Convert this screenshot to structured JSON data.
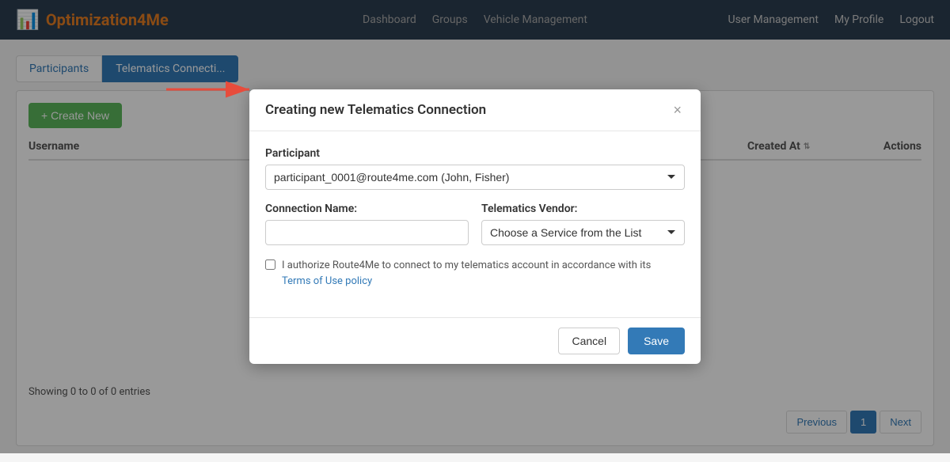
{
  "header": {
    "logo_text_before": "Optimization",
    "logo_text_highlight": "4Me",
    "nav_center": [
      "Dashboard",
      "Groups",
      "Vehicle Management"
    ],
    "nav_right": [
      "User Management",
      "My Profile",
      "Logout"
    ]
  },
  "tabs": [
    {
      "label": "Participants",
      "active": false
    },
    {
      "label": "Telematics Connecti...",
      "active": true
    }
  ],
  "toolbar": {
    "create_button_label": "+ Create New"
  },
  "table": {
    "columns": [
      {
        "label": "Username"
      },
      {
        "label": "Created At",
        "sortable": true
      },
      {
        "label": "Actions"
      }
    ],
    "showing_text": "Showing 0 to 0 of 0 entries"
  },
  "pagination": {
    "previous_label": "Previous",
    "next_label": "Next",
    "current_page": 1
  },
  "modal": {
    "title": "Creating new Telematics Connection",
    "close_label": "×",
    "participant_label": "Participant",
    "participant_value": "participant_0001@route4me.com (John, Fisher)",
    "connection_name_label": "Connection Name:",
    "connection_name_placeholder": "",
    "vendor_label": "Telematics Vendor:",
    "vendor_placeholder": "Choose a Service from the List",
    "auth_checkbox_text": "I authorize Route4Me to connect to my telematics account in accordance with its",
    "terms_link_text": "Terms of Use policy",
    "cancel_label": "Cancel",
    "save_label": "Save"
  }
}
